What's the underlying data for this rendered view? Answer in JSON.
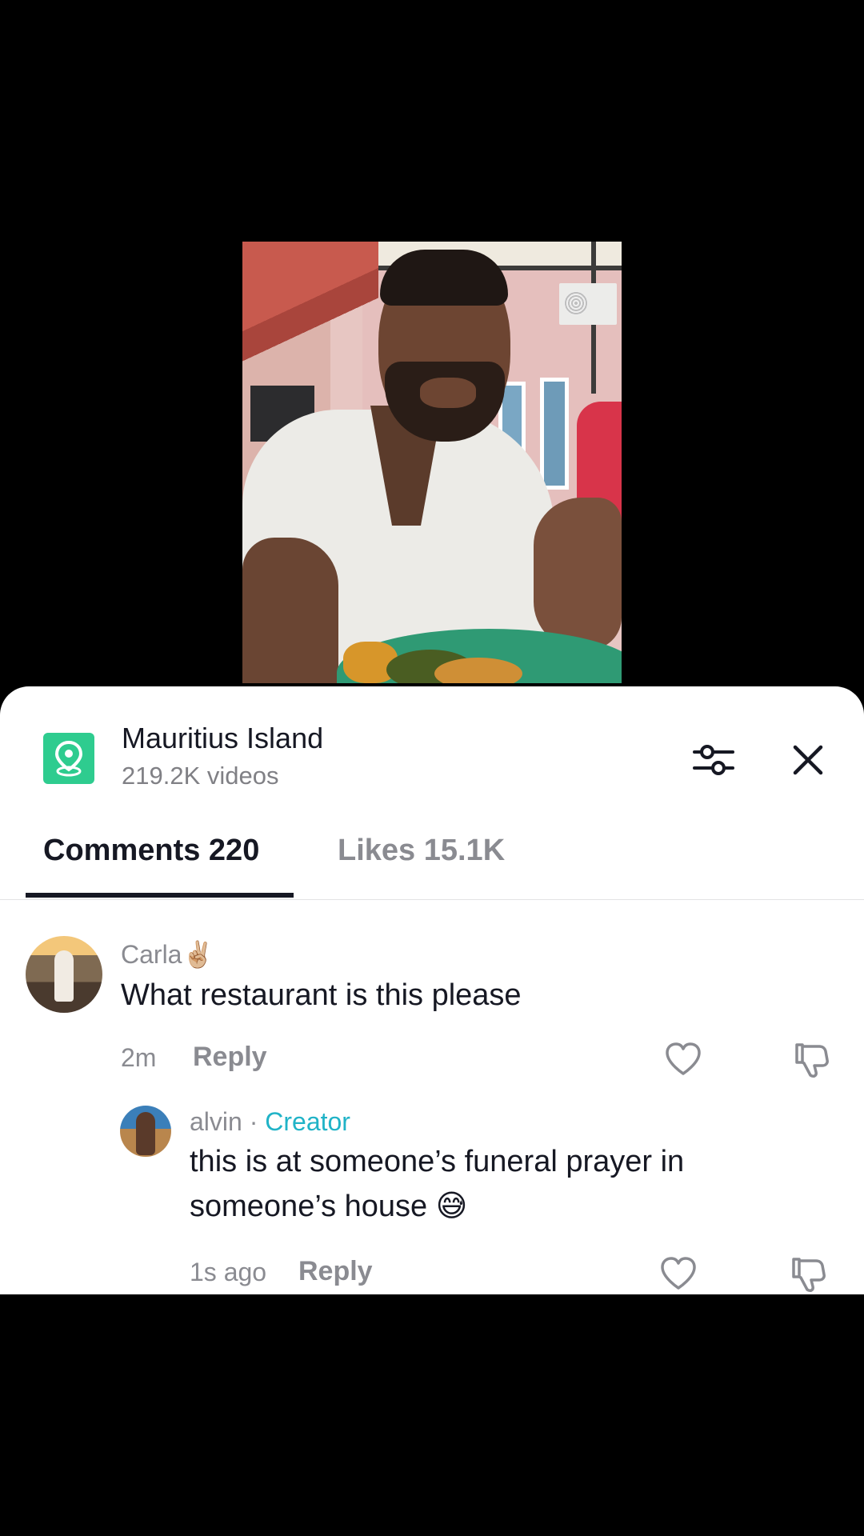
{
  "overlay_emoji": "😭",
  "location": {
    "title": "Mauritius Island",
    "video_count": "219.2K videos",
    "icon": "location-pin-icon",
    "accent": "#2ECC8F"
  },
  "tabs": [
    {
      "label": "Comments 220",
      "active": true
    },
    {
      "label": "Likes 15.1K",
      "active": false
    }
  ],
  "comments": [
    {
      "username": "Carla",
      "username_emoji": "✌🏼",
      "text": "What restaurant is this please",
      "time": "2m",
      "reply_label": "Reply",
      "replies": [
        {
          "username": "alvin",
          "separator": " · ",
          "badge": "Creator",
          "badge_color": "#20B3C7",
          "text": "this is at someone’s funeral prayer in\nsomeone’s house 😅",
          "time": "1s ago",
          "reply_label": "Reply"
        }
      ]
    }
  ],
  "colors": {
    "text_primary": "#161823",
    "text_secondary": "#8A8B91"
  }
}
